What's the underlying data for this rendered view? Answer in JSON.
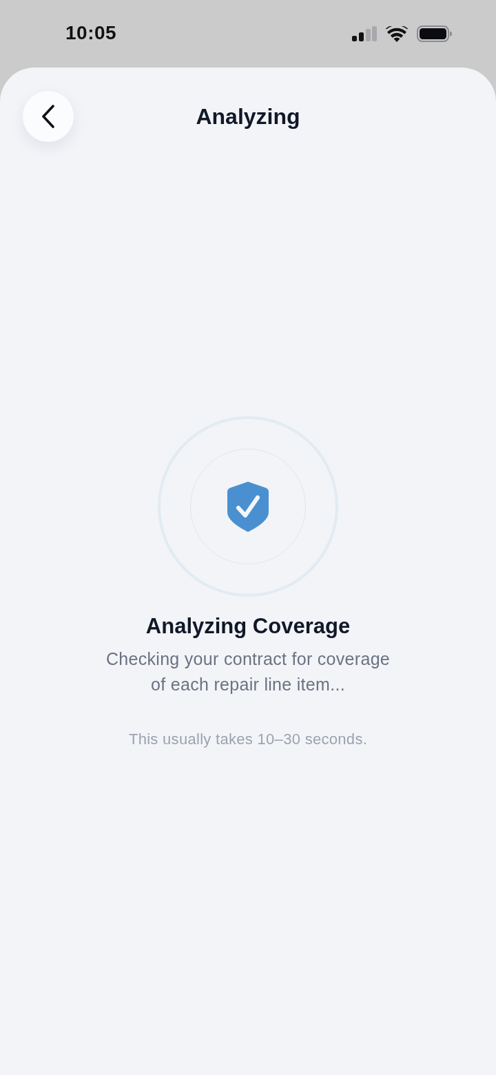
{
  "status_bar": {
    "time": "10:05"
  },
  "header": {
    "title": "Analyzing"
  },
  "loader": {
    "title": "Analyzing Coverage",
    "description": "Checking your contract for coverage of each repair line item...",
    "hint": "This usually takes 10–30 seconds."
  }
}
